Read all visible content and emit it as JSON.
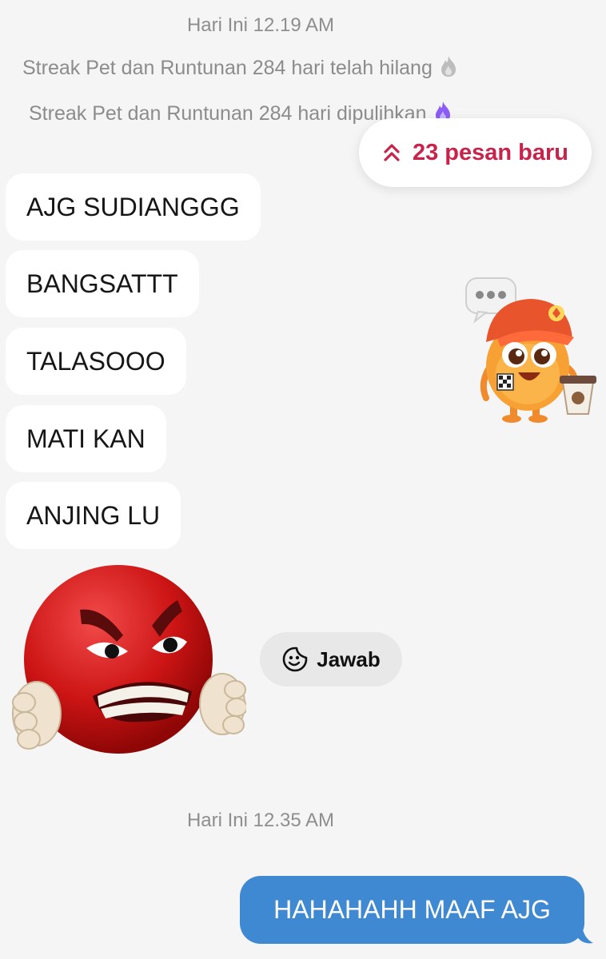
{
  "chat": {
    "timestamp_1": "Hari Ini 12.19 AM",
    "system_1": "Streak Pet dan Runtunan 284 hari telah hilang",
    "system_2": "Streak Pet dan Runtunan 284 hari dipulihkan",
    "new_messages": "23 pesan baru",
    "incoming": [
      "AJG SUDIANGGG",
      "BANGSATTT",
      "TALASOOO",
      "MATI KAN",
      "ANJING LU"
    ],
    "reply_label": "Jawab",
    "timestamp_2": "Hari Ini 12.35 AM",
    "outgoing": "HAHAHAHH MAAF AJG"
  },
  "icons": {
    "system_1": "fire-icon-grey",
    "system_2": "fire-icon-purple",
    "new_messages": "double-chevron-up-icon",
    "reply": "sticker-smile-icon",
    "sticker_1": "pet-mascot-sticker",
    "sticker_2": "angry-red-ball-sticker"
  },
  "colors": {
    "background": "#f5f5f5",
    "new_messages_accent": "#c8234b",
    "outgoing_bubble": "#3f89d2",
    "fire_purple": "#8b5cf6"
  }
}
